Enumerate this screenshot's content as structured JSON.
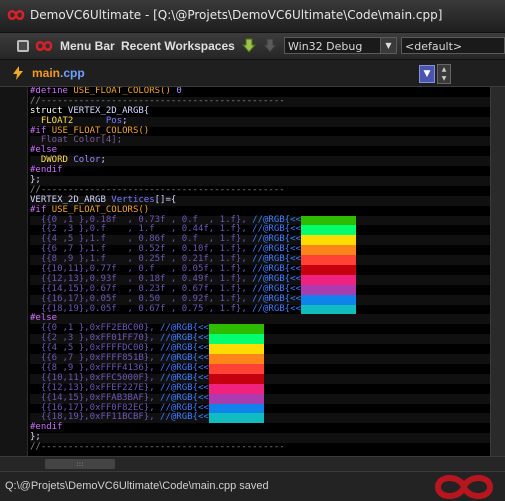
{
  "window": {
    "title": "DemoVC6Ultimate - [Q:\\@Projets\\DemoVC6Ultimate\\Code\\main.cpp]"
  },
  "toolbar": {
    "menu_bar_label": "Menu Bar",
    "recent_workspaces_label": "Recent Workspaces",
    "config_value": "Win32 Debug",
    "platform_value": "<default>"
  },
  "tab": {
    "name": "main",
    "ext": ".cpp"
  },
  "editor": {
    "lines": [
      {
        "t": "#define USE_FLOAT_COLORS() 0"
      },
      {
        "t": "//---------------------------------------------"
      },
      {
        "t": "struct VERTEX_2D_ARGB{"
      },
      {
        "t": "  FLOAT2      Pos;"
      },
      {
        "t": "#if USE_FLOAT_COLORS()"
      },
      {
        "t": "  Float Color[4];"
      },
      {
        "t": "#else"
      },
      {
        "t": "  DWORD Color;"
      },
      {
        "t": "#endif"
      },
      {
        "t": "};"
      },
      {
        "t": "//---------------------------------------------"
      },
      {
        "t": "VERTEX_2D_ARGB Vertices[]={"
      },
      {
        "t": "#if USE_FLOAT_COLORS()"
      },
      {
        "t": "  {{0 ,1 },0.18f  , 0.73f , 0.f  , 1.f}, //@RGB{<<<"
      },
      {
        "t": "  {{2 ,3 },0.f    , 1.f   , 0.44f, 1.f}, //@RGB{<<<"
      },
      {
        "t": "  {{4 ,5 },1.f    , 0.86f , 0.f  , 1.f}, //@RGB{<<<"
      },
      {
        "t": "  {{6 ,7 },1.f    , 0.52f , 0.10f, 1.f}, //@RGB{<<<"
      },
      {
        "t": "  {{8 ,9 },1.f    , 0.25f , 0.21f, 1.f}, //@RGB{<<<"
      },
      {
        "t": "  {{10,11},0.77f  , 0.f   , 0.05f, 1.f}, //@RGB{<<<"
      },
      {
        "t": "  {{12,13},0.93f  , 0.18f , 0.49f, 1.f}, //@RGB{<<<"
      },
      {
        "t": "  {{14,15},0.67f  , 0.23f , 0.67f, 1.f}, //@RGB{<<<"
      },
      {
        "t": "  {{16,17},0.05f  , 0.50  , 0.92f, 1.f}, //@RGB{<<<"
      },
      {
        "t": "  {{18,19},0.05f  , 0.67f , 0.75 , 1.f}, //@RGB{<<<"
      },
      {
        "t": "#else"
      },
      {
        "t": "  {{0 ,1 },0xFF2EBC00}, //@RGB{<<<"
      },
      {
        "t": "  {{2 ,3 },0xFF01FF70}, //@RGB{<<<"
      },
      {
        "t": "  {{4 ,5 },0xFFFFDC00}, //@RGB{<<<"
      },
      {
        "t": "  {{6 ,7 },0xFFFF851B}, //@RGB{<<<"
      },
      {
        "t": "  {{8 ,9 },0xFFFF4136}, //@RGB{<<<"
      },
      {
        "t": "  {{10,11},0xFFC5000F}, //@RGB{<<<"
      },
      {
        "t": "  {{12,13},0xFFEF227E}, //@RGB{<<<"
      },
      {
        "t": "  {{14,15},0xFFAB3BAF}, //@RGB{<<<"
      },
      {
        "t": "  {{16,17},0xFF0F82EC}, //@RGB{<<<"
      },
      {
        "t": "  {{18,19},0xFF11BCBF}, //@RGB{<<<"
      },
      {
        "t": "#endif"
      },
      {
        "t": "};"
      },
      {
        "t": "//---------------------------------------------"
      }
    ],
    "swatches_float": [
      "#2EBC00",
      "#01FF70",
      "#FFDC00",
      "#FF851B",
      "#FF4136",
      "#C5000F",
      "#EF227E",
      "#AB3BAF",
      "#0F82EC",
      "#11BCBF"
    ],
    "swatches_hex": [
      "#2EBC00",
      "#01FF70",
      "#FFDC00",
      "#FF851B",
      "#FF4136",
      "#C5000F",
      "#EF227E",
      "#AB3BAF",
      "#0F82EC",
      "#11BCBF"
    ]
  },
  "status": {
    "text": "Q:\\@Projets\\DemoVC6Ultimate\\Code\\main.cpp saved"
  },
  "colors": {
    "preprocessor": "#d070ff",
    "keyword": "#ffffff",
    "type": "#c8c0ff",
    "macro": "#f5a623",
    "comment": "#8a8a8a",
    "dim": "#6d57b3",
    "rgb_tag": "#3f7dff",
    "tab_name": "#f29a1f"
  }
}
